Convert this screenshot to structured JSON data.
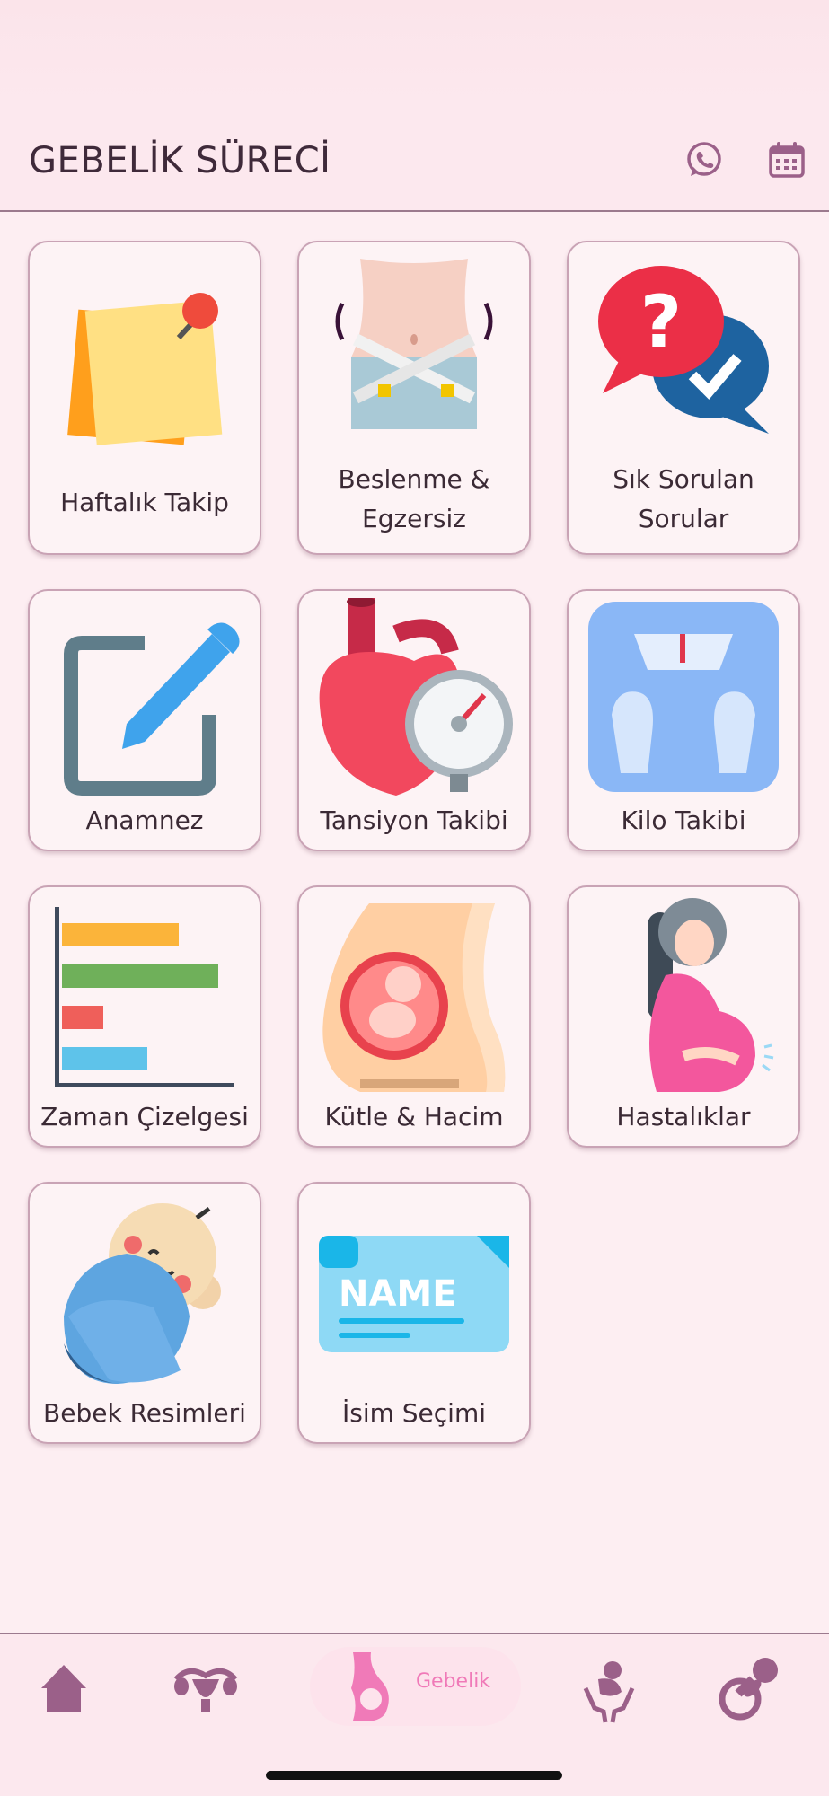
{
  "header": {
    "title": "GEBELİK SÜRECİ",
    "whatsapp_icon": "whatsapp-icon",
    "calendar_icon": "calendar-icon"
  },
  "cards": [
    {
      "label": "Haftalık Takip",
      "icon": "sticky-notes-pin-icon"
    },
    {
      "label": "Beslenme & Egzersiz",
      "label_line1": "Beslenme &",
      "label_line2": "Egzersiz",
      "icon": "waist-measure-icon"
    },
    {
      "label": "Sık Sorulan Sorular",
      "label_line1": "Sık Sorulan",
      "label_line2": "Sorular",
      "icon": "faq-bubbles-icon"
    },
    {
      "label": "Anamnez",
      "icon": "edit-note-icon"
    },
    {
      "label": "Tansiyon Takibi",
      "icon": "heart-gauge-icon"
    },
    {
      "label": "Kilo Takibi",
      "icon": "weight-scale-icon"
    },
    {
      "label": "Zaman Çizelgesi",
      "icon": "bar-timeline-icon"
    },
    {
      "label": "Kütle & Hacim",
      "icon": "pregnant-belly-fetus-icon"
    },
    {
      "label": "Hastalıklar",
      "icon": "pregnant-woman-icon"
    },
    {
      "label": "Bebek Resimleri",
      "icon": "swaddled-baby-icon"
    },
    {
      "label": "İsim Seçimi",
      "icon": "name-tag-icon"
    }
  ],
  "bottom_nav": {
    "items": [
      {
        "icon": "home-icon"
      },
      {
        "icon": "uterus-icon"
      },
      {
        "icon": "pregnancy-icon",
        "label": "Gebelik",
        "active": true
      },
      {
        "icon": "baby-care-hands-icon"
      },
      {
        "icon": "pacifier-icon"
      }
    ]
  },
  "colors": {
    "background": "#fdeef2",
    "accent": "#f07ab8",
    "header_text": "#3f2a3a",
    "nav_icon": "#9b6089"
  }
}
